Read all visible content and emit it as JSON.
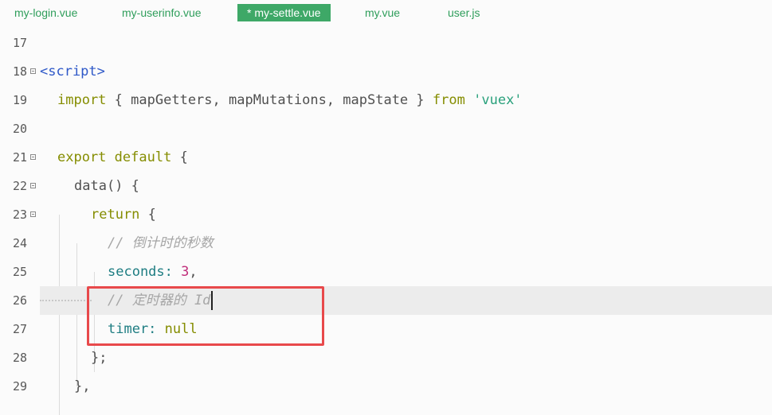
{
  "tabs": [
    {
      "label": "my-login.vue",
      "active": false
    },
    {
      "label": "my-userinfo.vue",
      "active": false
    },
    {
      "label": "* my-settle.vue",
      "active": true
    },
    {
      "label": "my.vue",
      "active": false
    },
    {
      "label": "user.js",
      "active": false
    }
  ],
  "editor": {
    "line_numbers": [
      "17",
      "18",
      "19",
      "20",
      "21",
      "22",
      "23",
      "24",
      "25",
      "26",
      "27",
      "28",
      "29"
    ],
    "current_line": "26",
    "lines": {
      "l18": {
        "script_tag": "<script>"
      },
      "l19": {
        "import": "import",
        "open": "{",
        "names": "mapGetters, mapMutations, mapState",
        "close": "}",
        "from": "from",
        "module": "'vuex'"
      },
      "l21": {
        "export": "export",
        "default": "default",
        "brace": "{"
      },
      "l22": {
        "text": "data() {"
      },
      "l23": {
        "return": "return",
        "brace": "{"
      },
      "l24": {
        "comment": "// 倒计时的秒数"
      },
      "l25": {
        "key": "seconds:",
        "value": "3",
        "punct": ","
      },
      "l26": {
        "comment": "// 定时器的 Id"
      },
      "l27": {
        "key": "timer:",
        "value": "null"
      },
      "l28": {
        "text": "};"
      },
      "l29": {
        "text": "},"
      }
    }
  },
  "colors": {
    "tab_active_bg": "#3ea867",
    "tab_text": "#2f9e5b",
    "keyword": "#858d00",
    "string": "#2aa17c",
    "property": "#1e7d82",
    "number": "#c02e7a",
    "comment": "#a6a6a6",
    "highlight_box": "#e8494b"
  }
}
